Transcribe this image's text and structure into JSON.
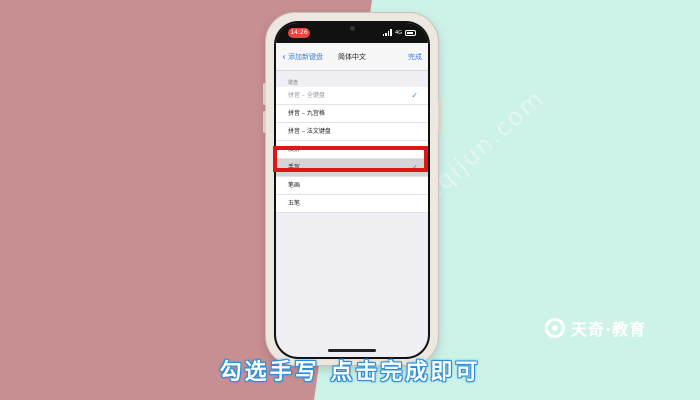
{
  "watermark": "jiaoyu.tianqijun.com",
  "brand": {
    "name": "天奇·教育"
  },
  "caption": "勾选手写 点击完成即可",
  "phone": {
    "statusbar": {
      "time": "14:26",
      "network": "4G"
    },
    "navbar": {
      "back_label": "添加新键盘",
      "title": "简体中文",
      "done_label": "完成"
    },
    "section_header": "键盘",
    "keyboards": [
      {
        "label": "拼音 – 全键盘",
        "checked": true,
        "disabled": true
      },
      {
        "label": "拼音 – 九宫格",
        "checked": false,
        "disabled": false
      },
      {
        "label": "拼音 – 法文键盘",
        "checked": false,
        "disabled": false
      },
      {
        "label": "双拼",
        "checked": false,
        "disabled": false
      },
      {
        "label": "手写",
        "checked": true,
        "disabled": false,
        "highlighted": true
      },
      {
        "label": "笔画",
        "checked": false,
        "disabled": false
      },
      {
        "label": "五笔",
        "checked": false,
        "disabled": false
      }
    ]
  },
  "colors": {
    "accent": "#3b7fe0",
    "highlight_box": "#e01515",
    "background_left": "#c88f92",
    "background_right": "#cdf2e8"
  }
}
